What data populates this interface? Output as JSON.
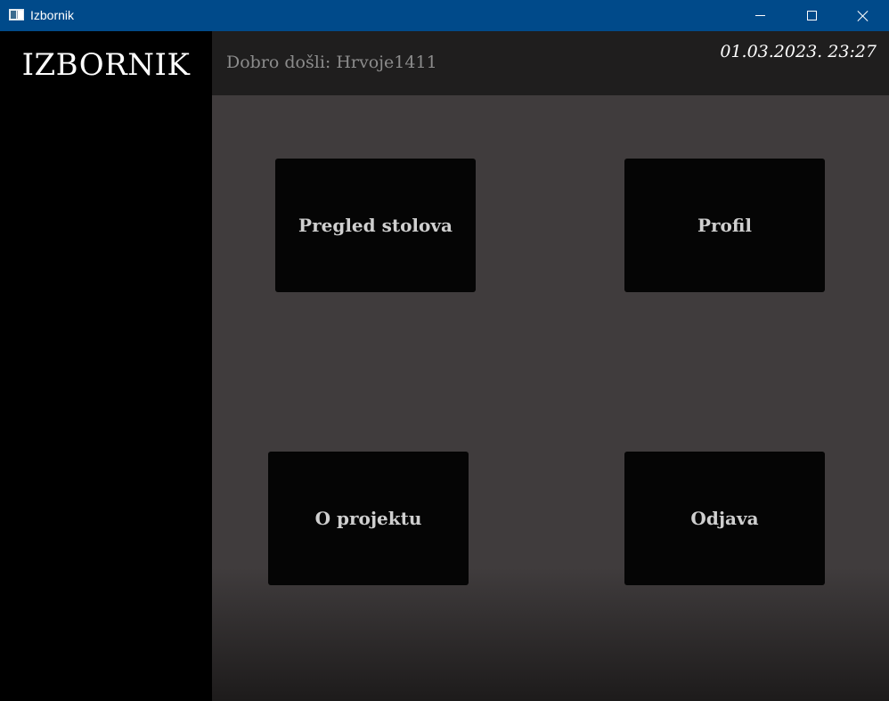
{
  "window": {
    "title": "Izbornik",
    "icons": {
      "app": "app-window-icon",
      "minimize": "minimize-icon",
      "maximize": "maximize-icon",
      "close": "close-icon"
    }
  },
  "sidebar": {
    "title": "IZBORNIK"
  },
  "header": {
    "welcome": "Dobro došli: Hrvoje1411",
    "datetime": "01.03.2023. 23:27"
  },
  "menu": {
    "tiles": [
      {
        "label": "Pregled stolova"
      },
      {
        "label": "Profil"
      },
      {
        "label": "O projektu"
      },
      {
        "label": "Odjava"
      }
    ]
  },
  "colors": {
    "titlebar": "#004a8a",
    "sidebar": "#000000",
    "header": "#1f1e1e",
    "main": "#403c3d",
    "tile": "#050505",
    "tile_text": "#cfcfcf"
  }
}
